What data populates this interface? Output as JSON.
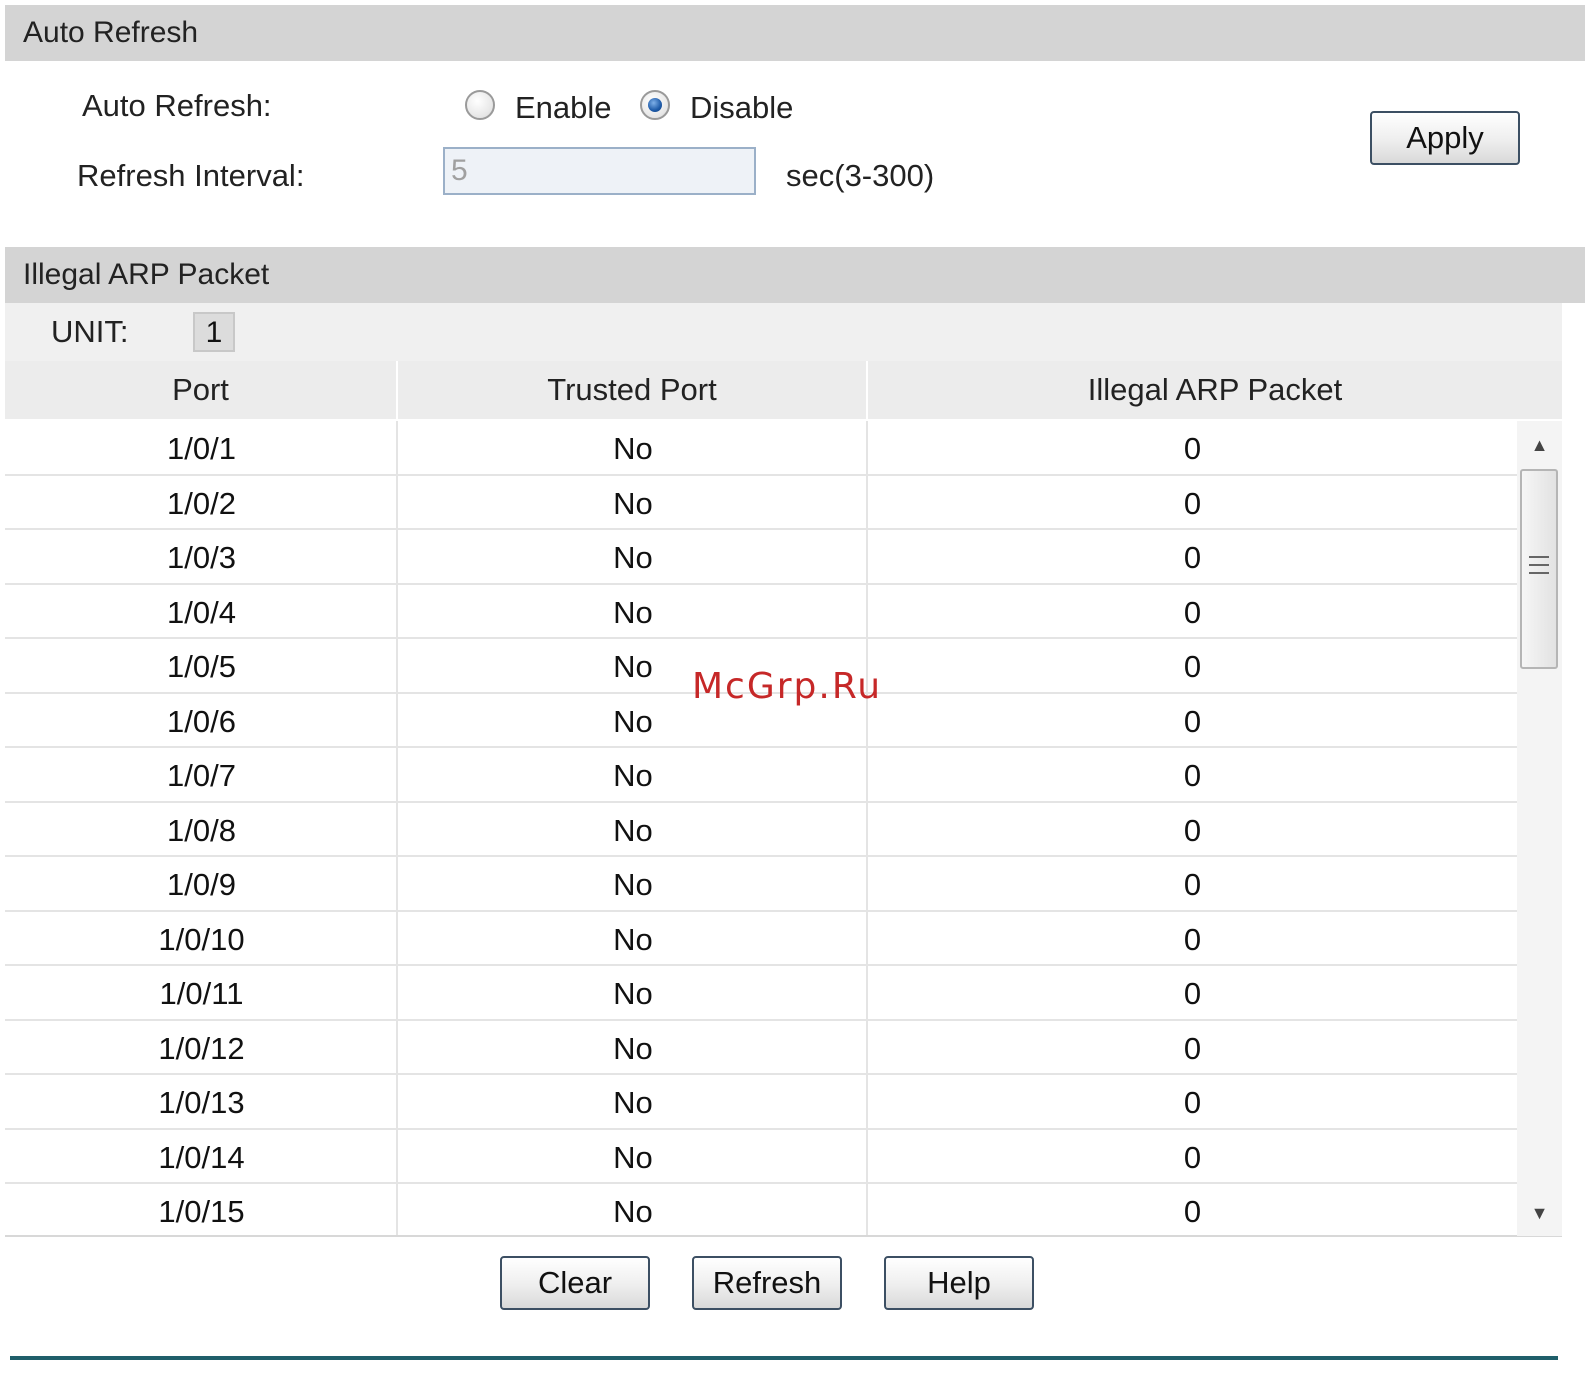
{
  "auto_refresh": {
    "section_title": "Auto Refresh",
    "auto_refresh_label": "Auto Refresh:",
    "enable_label": "Enable",
    "disable_label": "Disable",
    "selected": "Disable",
    "interval_label": "Refresh Interval:",
    "interval_value": "5",
    "interval_hint": "sec(3-300)",
    "apply_label": "Apply"
  },
  "illegal_arp": {
    "section_title": "Illegal ARP Packet",
    "unit_label": "UNIT:",
    "unit_value": "1",
    "columns": [
      "Port",
      "Trusted Port",
      "Illegal ARP Packet"
    ],
    "rows": [
      {
        "port": "1/0/1",
        "trusted": "No",
        "illegal": "0"
      },
      {
        "port": "1/0/2",
        "trusted": "No",
        "illegal": "0"
      },
      {
        "port": "1/0/3",
        "trusted": "No",
        "illegal": "0"
      },
      {
        "port": "1/0/4",
        "trusted": "No",
        "illegal": "0"
      },
      {
        "port": "1/0/5",
        "trusted": "No",
        "illegal": "0"
      },
      {
        "port": "1/0/6",
        "trusted": "No",
        "illegal": "0"
      },
      {
        "port": "1/0/7",
        "trusted": "No",
        "illegal": "0"
      },
      {
        "port": "1/0/8",
        "trusted": "No",
        "illegal": "0"
      },
      {
        "port": "1/0/9",
        "trusted": "No",
        "illegal": "0"
      },
      {
        "port": "1/0/10",
        "trusted": "No",
        "illegal": "0"
      },
      {
        "port": "1/0/11",
        "trusted": "No",
        "illegal": "0"
      },
      {
        "port": "1/0/12",
        "trusted": "No",
        "illegal": "0"
      },
      {
        "port": "1/0/13",
        "trusted": "No",
        "illegal": "0"
      },
      {
        "port": "1/0/14",
        "trusted": "No",
        "illegal": "0"
      },
      {
        "port": "1/0/15",
        "trusted": "No",
        "illegal": "0"
      }
    ]
  },
  "buttons": {
    "clear_label": "Clear",
    "refresh_label": "Refresh",
    "help_label": "Help"
  },
  "watermark": "McGrp.Ru",
  "colors": {
    "section_header_bg": "#d4d4d4",
    "footer_line": "#1f5f6a",
    "watermark": "#c62828"
  }
}
